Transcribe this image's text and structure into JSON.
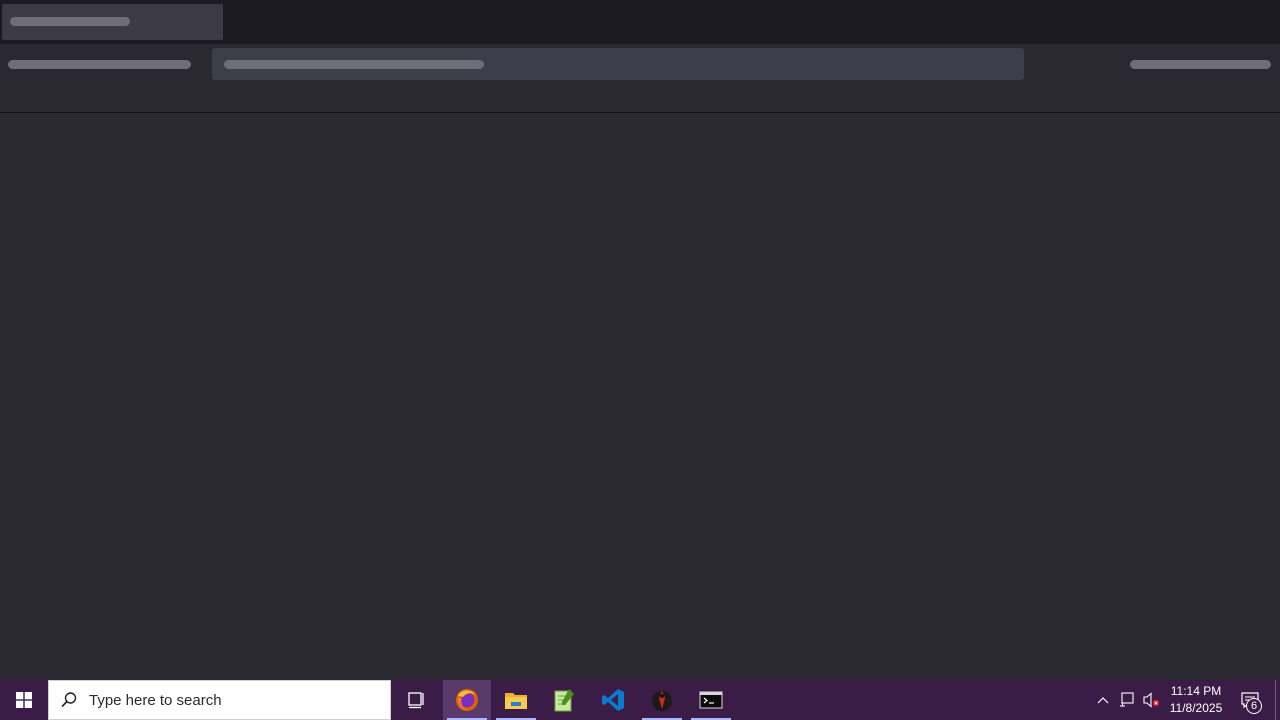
{
  "taskbar": {
    "search_placeholder": "Type here to search",
    "apps": [
      {
        "name": "Firefox",
        "icon": "firefox-icon",
        "active": true
      },
      {
        "name": "File Explorer",
        "icon": "file-explorer-icon",
        "active": false
      },
      {
        "name": "Notepad++",
        "icon": "notepad-plus-plus-icon",
        "active": false
      },
      {
        "name": "Visual Studio Code",
        "icon": "vscode-icon",
        "active": false
      },
      {
        "name": "Kali",
        "icon": "kali-dragon-icon",
        "active": false
      },
      {
        "name": "Terminal",
        "icon": "terminal-icon",
        "active": false
      }
    ],
    "clock": {
      "time": "11:14 PM",
      "date": "11/8/2025"
    },
    "notification_count": "6"
  },
  "colors": {
    "taskbar_bg": "#3b1c46",
    "browser_bg": "#2a2830",
    "titlebar_bg": "#1d1b22",
    "skeleton": "#6e6d78"
  }
}
